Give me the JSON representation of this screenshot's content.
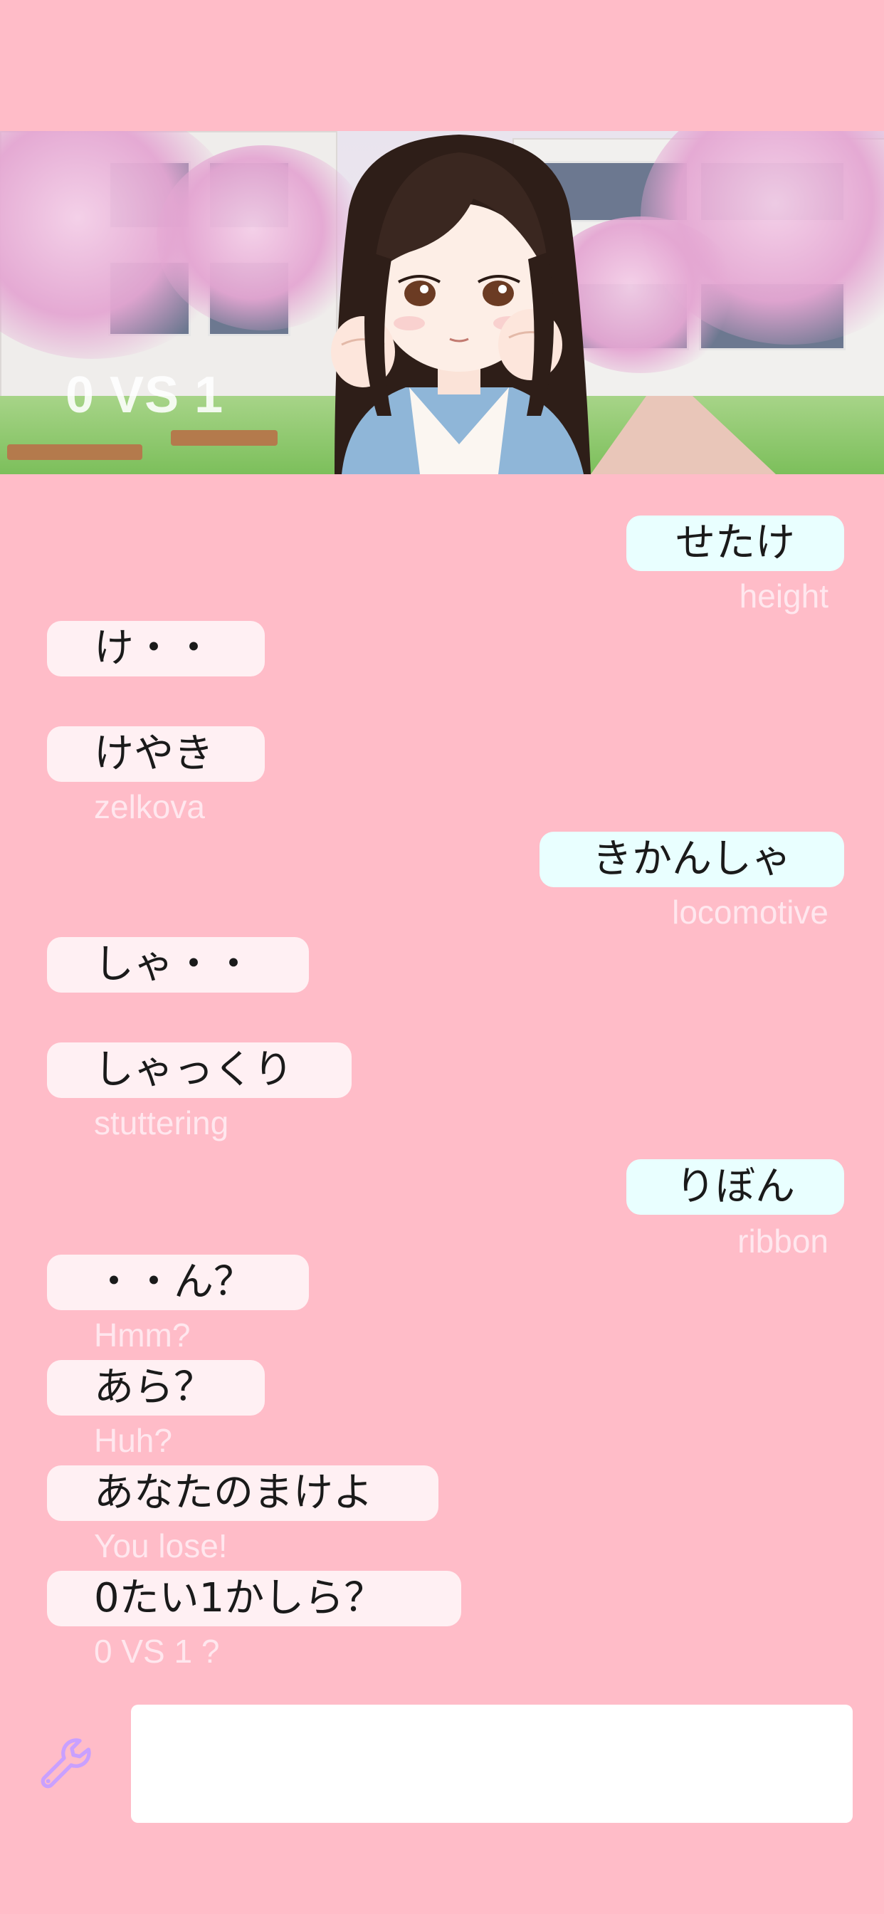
{
  "banner": {
    "score": "0 VS 1"
  },
  "messages": [
    {
      "side": "right",
      "text": "せたけ",
      "translation": "height"
    },
    {
      "side": "left",
      "text": "け・・",
      "translation": ""
    },
    {
      "side": "left",
      "text": "けやき",
      "translation": "zelkova"
    },
    {
      "side": "right",
      "text": "きかんしゃ",
      "translation": "locomotive"
    },
    {
      "side": "left",
      "text": "しゃ・・",
      "translation": ""
    },
    {
      "side": "left",
      "text": "しゃっくり",
      "translation": "stuttering"
    },
    {
      "side": "right",
      "text": "りぼん",
      "translation": "ribbon"
    },
    {
      "side": "left",
      "text": "・・ん？",
      "translation": "Hmm?"
    },
    {
      "side": "left",
      "text": "あら？",
      "translation": "Huh?"
    },
    {
      "side": "left",
      "text": "あなたのまけよ",
      "translation": "You lose!"
    },
    {
      "side": "left",
      "text": "0たい1かしら？",
      "translation": "0 VS 1 ?"
    }
  ],
  "input": {
    "value": "",
    "placeholder": "",
    "tool_icon": "wrench-icon"
  },
  "colors": {
    "background": "#ffbcc8",
    "left_bubble": "#fff0f3",
    "right_bubble": "#e9ffff",
    "translation_text": "#ffe7ee",
    "icon": "#c9a0ff"
  }
}
